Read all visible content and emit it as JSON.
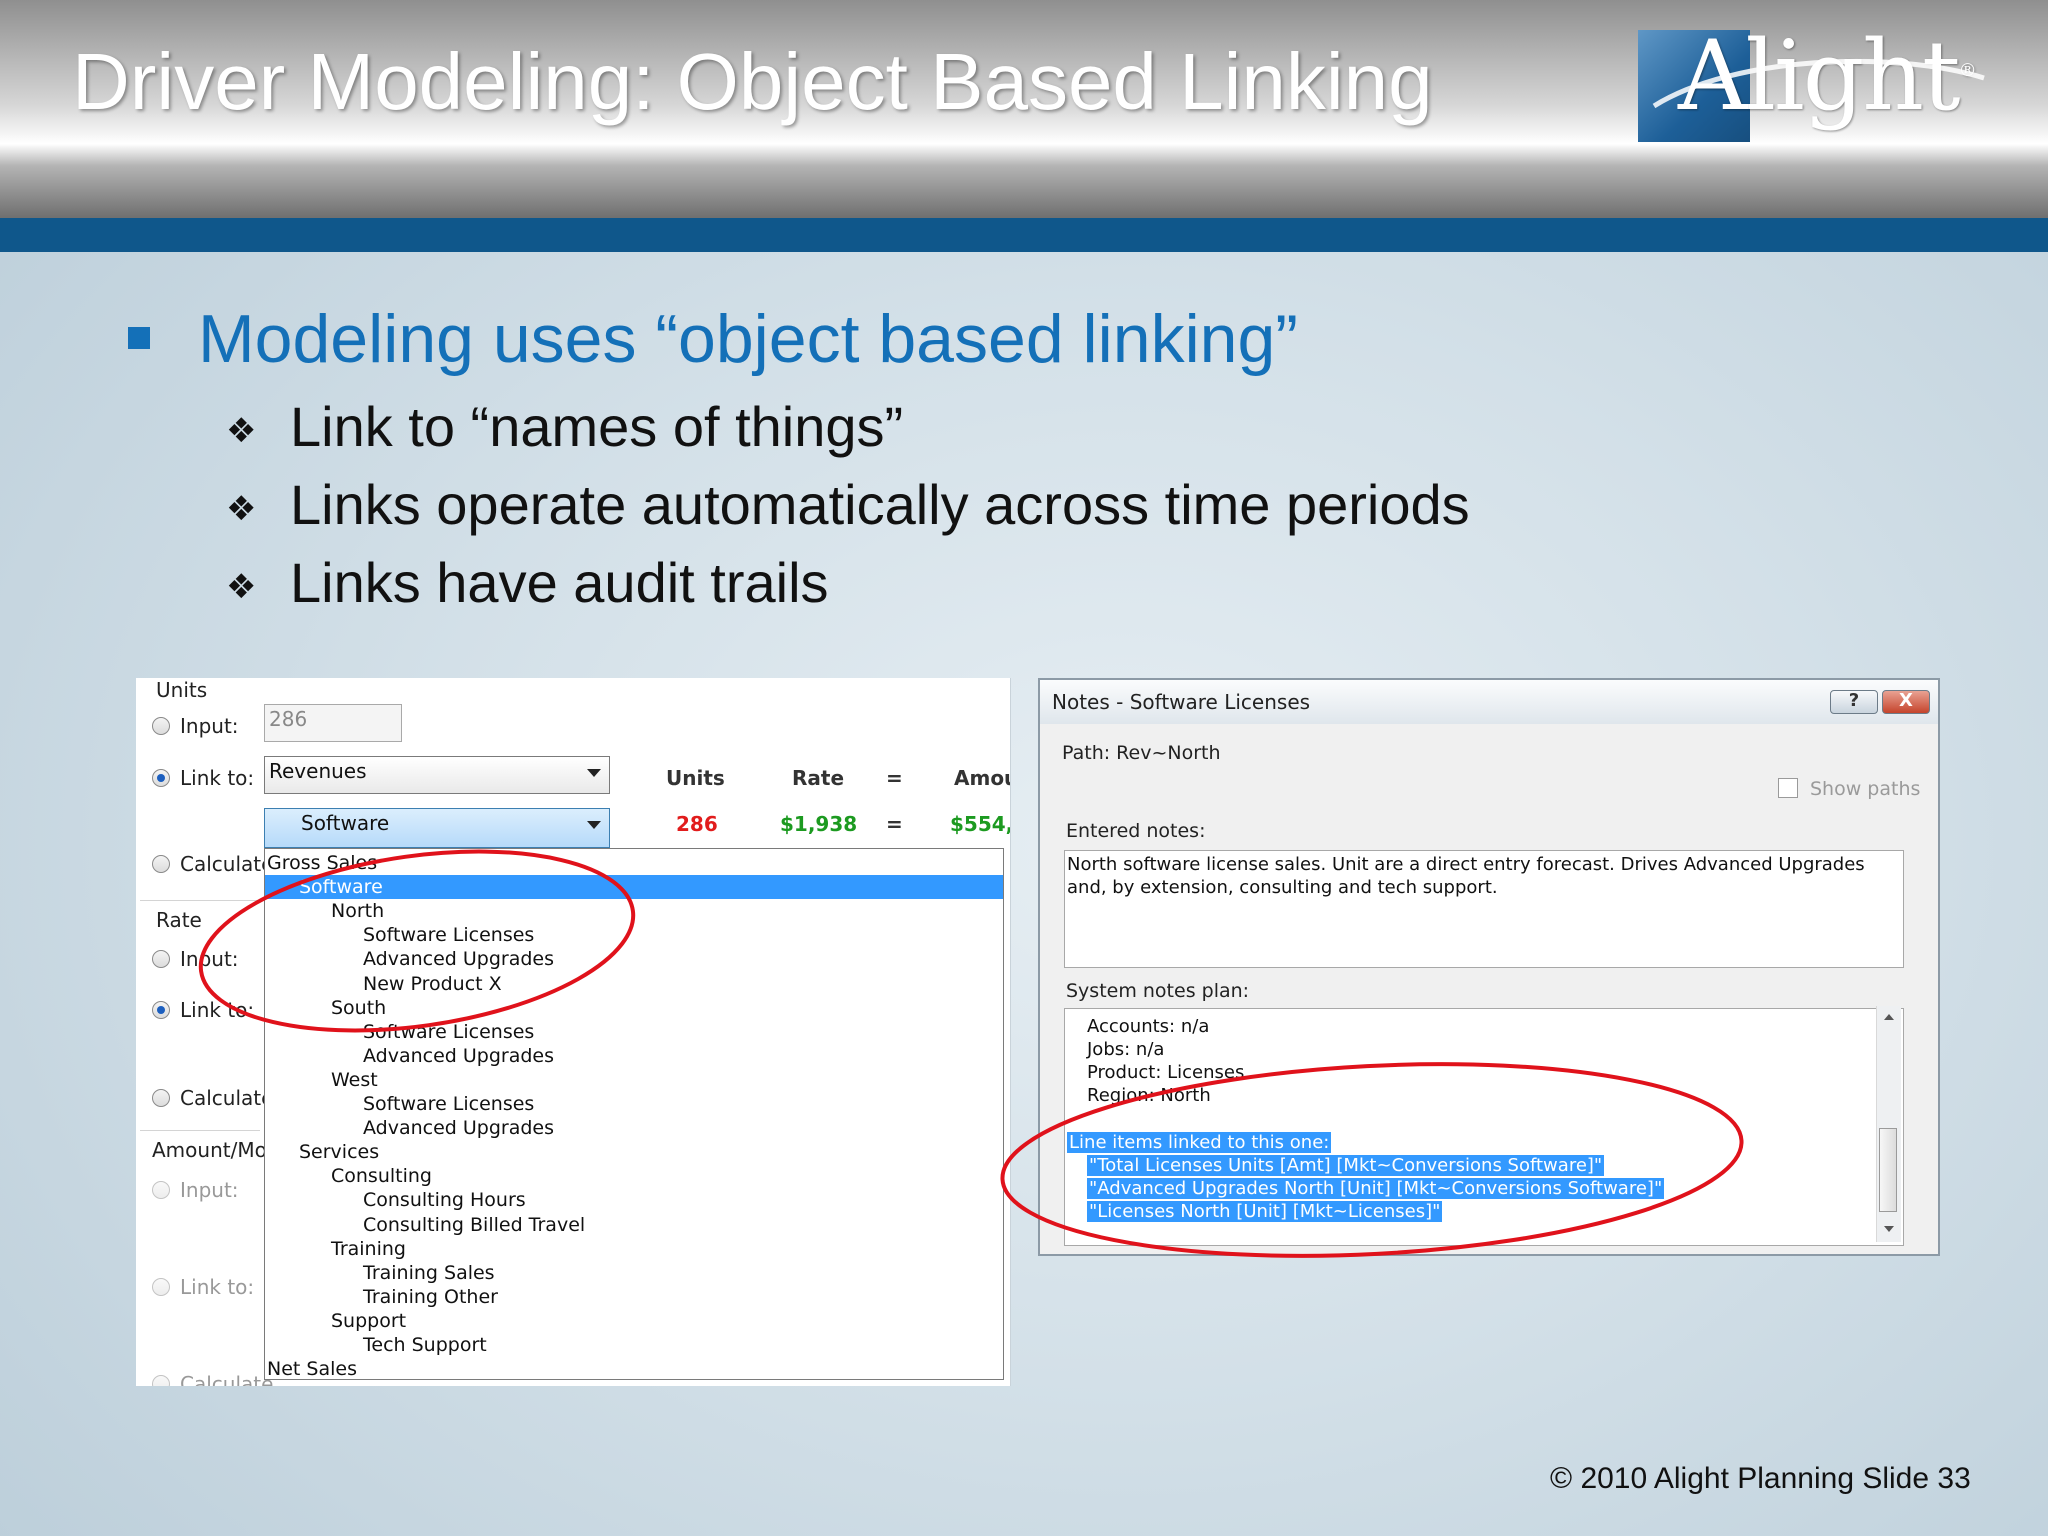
{
  "slide": {
    "title": "Driver Modeling: Object Based Linking",
    "logo_text": "Alight",
    "logo_reg": "®",
    "footer": "© 2010 Alight Planning Slide 33",
    "colors": {
      "header_bar": "#0f578b",
      "bullet": "#1470b8",
      "highlight_ellipse": "#e0121b",
      "selection": "#3399ff"
    }
  },
  "bullets": {
    "main": "Modeling uses “object based linking”",
    "subs": [
      "Link to “names of things”",
      "Links operate automatically across time periods",
      "Links have audit trails"
    ],
    "sub_marker_icon": "four-diamond-icon"
  },
  "form": {
    "units_group": "Units",
    "input_label": "Input:",
    "input_value": "286",
    "link_label": "Link to:",
    "link_combo_value": "Revenues",
    "link_combo2_value": "Software",
    "calculate_label": "Calculate",
    "rate_group": "Rate",
    "rate_input_label": "Input:",
    "rate_link_label": "Link to:",
    "rate_calculate_label": "Calculate",
    "amount_group": "Amount/Mor",
    "amount_input_label": "Input:",
    "amount_link_label": "Link to:",
    "amount_calculate_label": "Calculate",
    "table": {
      "headers": [
        "Units",
        "Rate",
        "=",
        "Amou"
      ],
      "values": [
        "286",
        "$1,938",
        "=",
        "$554,"
      ]
    }
  },
  "dropdown": {
    "items": [
      {
        "label": "Gross Sales",
        "level": 0
      },
      {
        "label": "Software",
        "level": 1,
        "selected": true
      },
      {
        "label": "North",
        "level": 2
      },
      {
        "label": "Software Licenses",
        "level": 3
      },
      {
        "label": "Advanced Upgrades",
        "level": 3
      },
      {
        "label": "New Product X",
        "level": 3
      },
      {
        "label": "South",
        "level": 2
      },
      {
        "label": "Software Licenses",
        "level": 3
      },
      {
        "label": "Advanced Upgrades",
        "level": 3
      },
      {
        "label": "West",
        "level": 2
      },
      {
        "label": "Software Licenses",
        "level": 3
      },
      {
        "label": "Advanced Upgrades",
        "level": 3
      },
      {
        "label": "Services",
        "level": 1
      },
      {
        "label": "Consulting",
        "level": 2
      },
      {
        "label": "Consulting Hours",
        "level": 3
      },
      {
        "label": "Consulting Billed Travel",
        "level": 3
      },
      {
        "label": "Training",
        "level": 2
      },
      {
        "label": "Training Sales",
        "level": 3
      },
      {
        "label": "Training Other",
        "level": 3
      },
      {
        "label": "Support",
        "level": 2
      },
      {
        "label": "Tech Support",
        "level": 3
      },
      {
        "label": "Net Sales",
        "level": 0
      }
    ]
  },
  "notes": {
    "title": "Notes - Software Licenses",
    "help_label": "?",
    "close_label": "X",
    "path": "Path: Rev~North",
    "show_paths_label": "Show paths",
    "entered_label": "Entered notes:",
    "entered_text": "North software license sales. Unit are a direct entry forecast. Drives Advanced Upgrades and, by extension, consulting and tech support.",
    "system_label": "System notes plan:",
    "system_lines": [
      "Accounts: n/a",
      "Jobs: n/a",
      "Product: Licenses",
      "Region: North"
    ],
    "linked_lines": [
      "Line items linked to this one:",
      "\"Total Licenses Units [Amt] [Mkt~Conversions Software]\"",
      "\"Advanced Upgrades North [Unit] [Mkt~Conversions Software]\"",
      "\"Licenses North [Unit] [Mkt~Licenses]\""
    ]
  }
}
